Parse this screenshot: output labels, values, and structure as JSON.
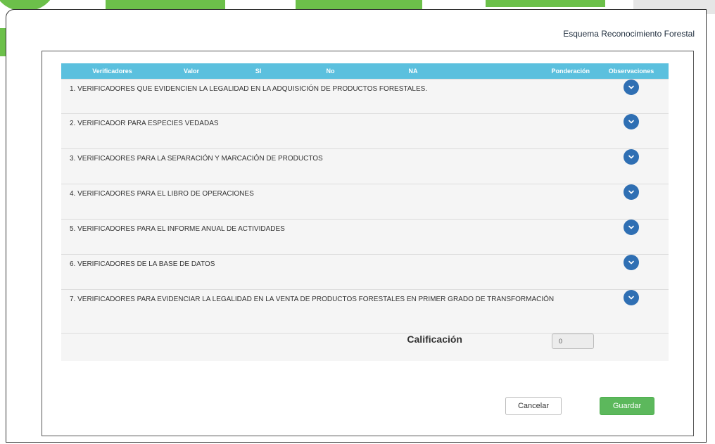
{
  "modal": {
    "title": "Esquema Reconocimiento Forestal"
  },
  "table": {
    "headers": [
      "Verificadores",
      "Valor",
      "SI",
      "No",
      "NA",
      "Ponderación",
      "Observaciones"
    ],
    "rows": [
      "1. VERIFICADORES QUE EVIDENCIEN LA LEGALIDAD EN LA ADQUISICIÓN DE PRODUCTOS FORESTALES.",
      "2. VERIFICADOR PARA ESPECIES VEDADAS",
      "3. VERIFICADORES PARA LA SEPARACIÓN Y MARCACIÓN DE PRODUCTOS",
      "4. VERIFICADORES PARA EL LIBRO DE OPERACIONES",
      "5. VERIFICADORES PARA EL INFORME ANUAL DE ACTIVIDADES",
      "6. VERIFICADORES DE LA BASE DE DATOS",
      "7. VERIFICADORES PARA EVIDENCIAR LA LEGALIDAD EN LA VENTA DE PRODUCTOS FORESTALES EN PRIMER GRADO DE TRANSFORMACIÓN"
    ],
    "expand_icon": "chevron-down-icon"
  },
  "calificacion": {
    "label": "Calificación",
    "value": "0"
  },
  "buttons": {
    "cancel": "Cancelar",
    "save": "Guardar"
  },
  "colors": {
    "header_bg": "#5bc0de",
    "expand_button": "#2f6fb3",
    "save_button": "#5cb85c",
    "brand_green": "#6cc04a"
  }
}
